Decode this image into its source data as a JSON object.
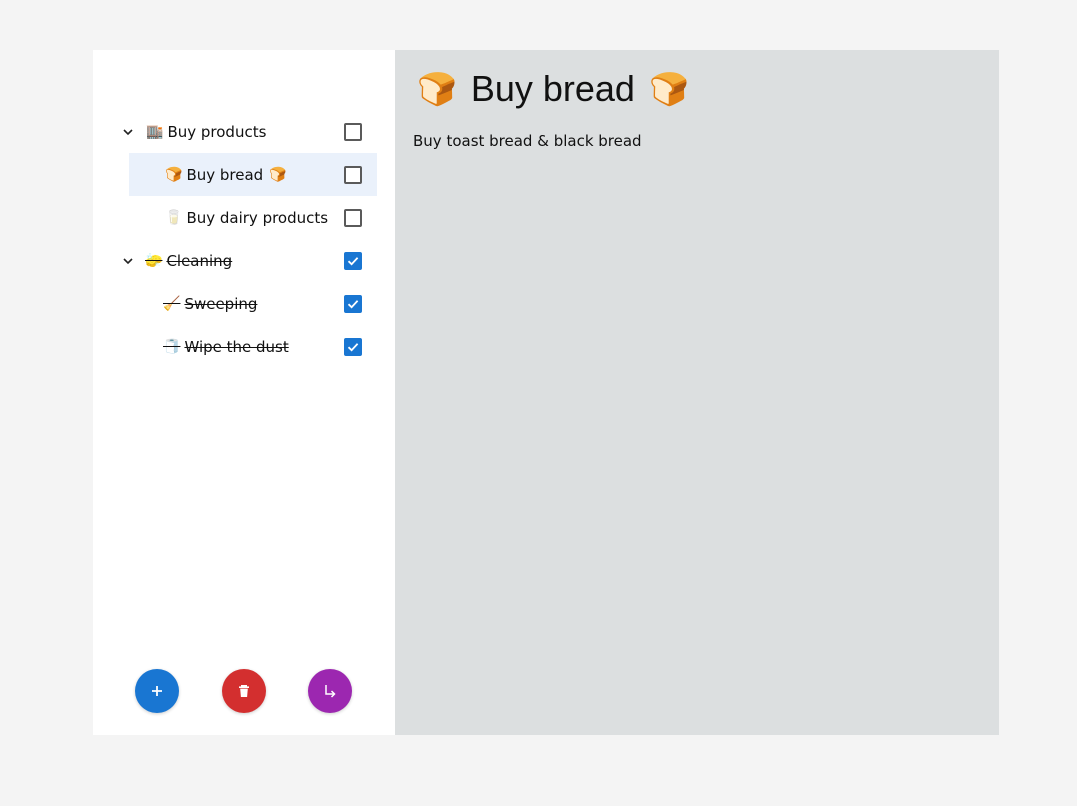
{
  "sidebar": {
    "items": [
      {
        "label": "Buy products",
        "emoji": "🏬",
        "checked": false
      },
      {
        "label": "Buy bread",
        "emoji": "🍞",
        "tail_emoji": "🍞",
        "checked": false,
        "selected": true
      },
      {
        "label": "Buy dairy products",
        "emoji": "🥛",
        "checked": false
      },
      {
        "label": "Cleaning",
        "emoji": "🧽",
        "checked": true
      },
      {
        "label": "Sweeping",
        "emoji": "🧹",
        "checked": true
      },
      {
        "label": "Wipe the dust",
        "emoji": "🧻",
        "checked": true
      }
    ],
    "buttons": {
      "add": {
        "icon": "plus-icon",
        "color": "#1976d2"
      },
      "delete": {
        "icon": "trash-icon",
        "color": "#d32f2f"
      },
      "move": {
        "icon": "subdirectory-arrow-icon",
        "color": "#9c27b0"
      }
    }
  },
  "main": {
    "title": "Buy bread",
    "title_emoji": "🍞",
    "description": "Buy toast bread & black bread"
  },
  "colors": {
    "accent": "#1976d2",
    "selected_row": "#eaf1fb",
    "main_bg": "#dcdfe0"
  }
}
